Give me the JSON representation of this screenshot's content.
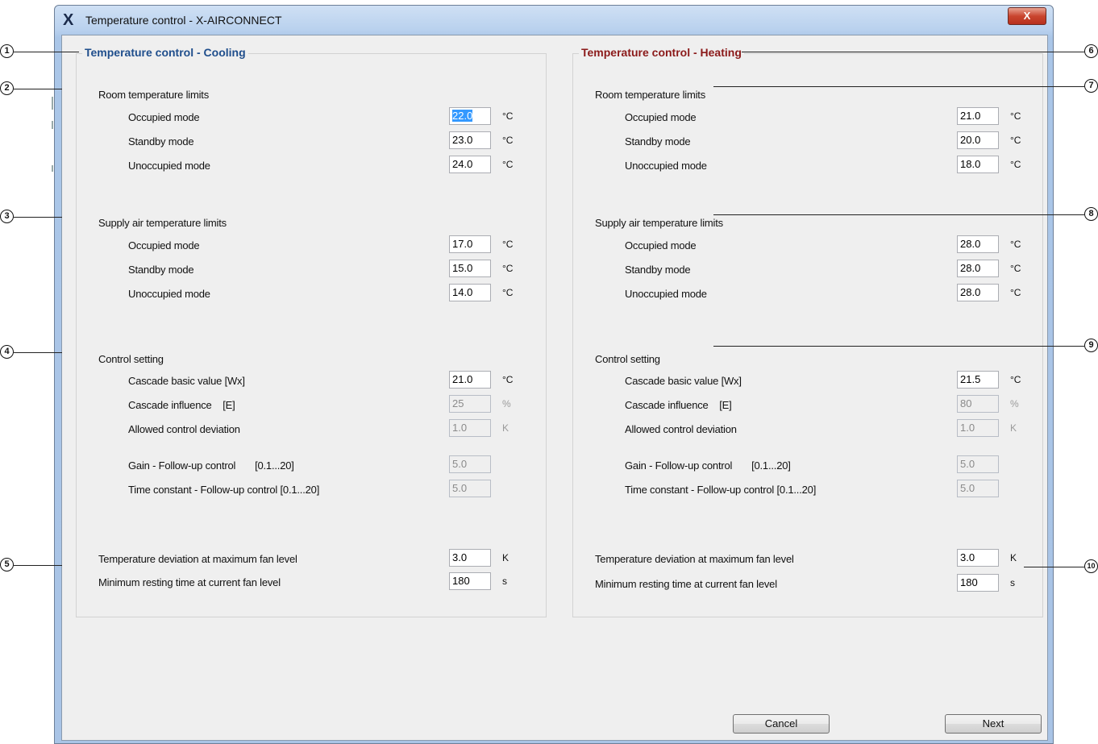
{
  "window": {
    "title": "Temperature control  - X-AIRCONNECT",
    "app_icon": "X",
    "close_label": "X"
  },
  "cooling": {
    "title": "Temperature control - Cooling",
    "room": {
      "heading": "Room temperature limits",
      "occupied": {
        "label": "Occupied mode",
        "value": "22.0",
        "unit": "°C"
      },
      "standby": {
        "label": "Standby mode",
        "value": "23.0",
        "unit": "°C"
      },
      "unoccupied": {
        "label": "Unoccupied mode",
        "value": "24.0",
        "unit": "°C"
      }
    },
    "supply": {
      "heading": "Supply air temperature limits",
      "occupied": {
        "label": "Occupied mode",
        "value": "17.0",
        "unit": "°C"
      },
      "standby": {
        "label": "Standby mode",
        "value": "15.0",
        "unit": "°C"
      },
      "unoccupied": {
        "label": "Unoccupied mode",
        "value": "14.0",
        "unit": "°C"
      }
    },
    "control": {
      "heading": "Control setting",
      "cascade_basic": {
        "label": "Cascade basic value [Wx]",
        "value": "21.0",
        "unit": "°C"
      },
      "cascade_influence": {
        "label": "Cascade influence    [E]",
        "value": "25",
        "unit": "%"
      },
      "allowed_deviation": {
        "label": "Allowed control deviation",
        "value": "1.0",
        "unit": "K"
      },
      "gain": {
        "label": "Gain - Follow-up control       [0.1...20]",
        "value": "5.0"
      },
      "time_constant": {
        "label": "Time constant - Follow-up control [0.1...20]",
        "value": "5.0"
      }
    },
    "fan": {
      "temp_deviation": {
        "label": "Temperature deviation at maximum fan level",
        "value": "3.0",
        "unit": "K"
      },
      "resting_time": {
        "label": "Minimum resting time at current fan level",
        "value": "180",
        "unit": "s"
      }
    }
  },
  "heating": {
    "title": "Temperature control - Heating",
    "room": {
      "heading": "Room temperature limits",
      "occupied": {
        "label": "Occupied mode",
        "value": "21.0",
        "unit": "°C"
      },
      "standby": {
        "label": "Standby mode",
        "value": "20.0",
        "unit": "°C"
      },
      "unoccupied": {
        "label": "Unoccupied mode",
        "value": "18.0",
        "unit": "°C"
      }
    },
    "supply": {
      "heading": "Supply air temperature limits",
      "occupied": {
        "label": "Occupied mode",
        "value": "28.0",
        "unit": "°C"
      },
      "standby": {
        "label": "Standby mode",
        "value": "28.0",
        "unit": "°C"
      },
      "unoccupied": {
        "label": "Unoccupied mode",
        "value": "28.0",
        "unit": "°C"
      }
    },
    "control": {
      "heading": "Control setting",
      "cascade_basic": {
        "label": "Cascade basic value [Wx]",
        "value": "21.5",
        "unit": "°C"
      },
      "cascade_influence": {
        "label": "Cascade influence    [E]",
        "value": "80",
        "unit": "%"
      },
      "allowed_deviation": {
        "label": "Allowed control deviation",
        "value": "1.0",
        "unit": "K"
      },
      "gain": {
        "label": "Gain - Follow-up control       [0.1...20]",
        "value": "5.0"
      },
      "time_constant": {
        "label": "Time constant - Follow-up control [0.1...20]",
        "value": "5.0"
      }
    },
    "fan": {
      "temp_deviation": {
        "label": "Temperature deviation at maximum fan level",
        "value": "3.0",
        "unit": "K"
      },
      "resting_time": {
        "label": "Minimum resting time at current fan level",
        "value": "180",
        "unit": "s"
      }
    }
  },
  "buttons": {
    "cancel": "Cancel",
    "next": "Next"
  },
  "callouts": [
    "1",
    "2",
    "3",
    "4",
    "5",
    "6",
    "7",
    "8",
    "9",
    "10"
  ],
  "colors": {
    "cooling_title": "#1f4e8c",
    "heating_title": "#8b1a1a",
    "selection": "#3399ff"
  }
}
